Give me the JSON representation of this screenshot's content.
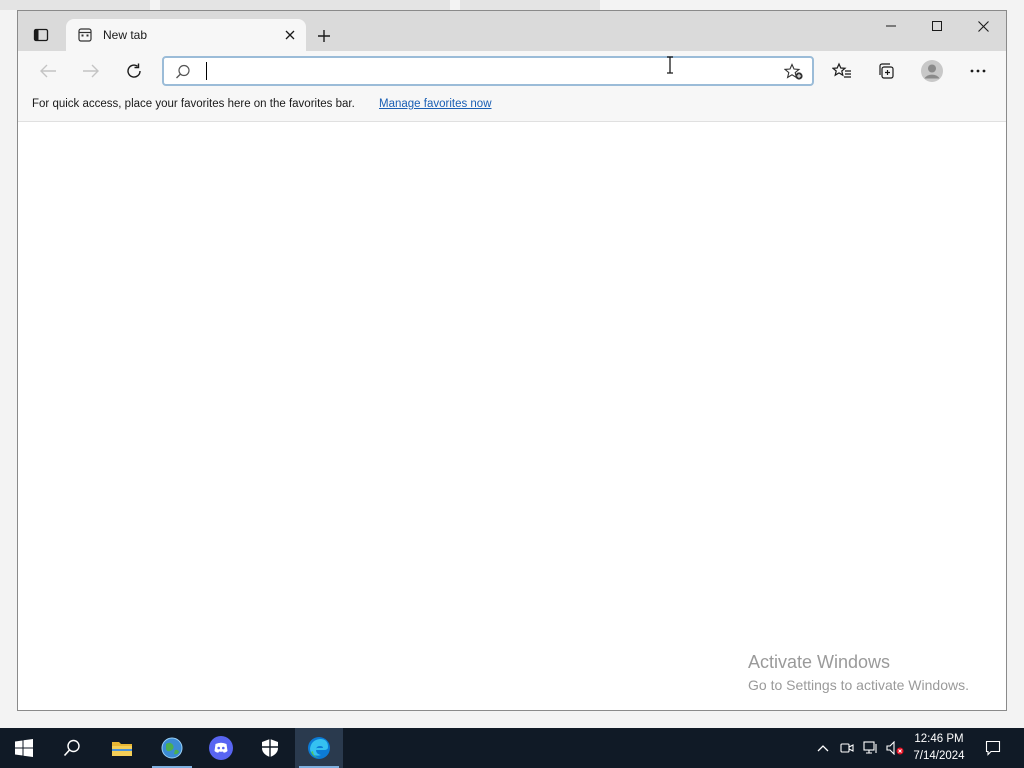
{
  "browser": {
    "tab": {
      "title": "New tab"
    },
    "address_bar": {
      "value": "",
      "placeholder": ""
    },
    "favorites_bar": {
      "message": "For quick access, place your favorites here on the favorites bar.",
      "link_label": "Manage favorites now"
    }
  },
  "watermark": {
    "title": "Activate Windows",
    "subtitle": "Go to Settings to activate Windows."
  },
  "taskbar": {
    "apps": [
      "start-icon",
      "search-icon",
      "file-explorer-icon",
      "browser-globe-icon",
      "discord-icon",
      "security-shield-icon",
      "edge-icon"
    ],
    "clock": {
      "time": "12:46 PM",
      "date": "7/14/2024"
    }
  },
  "colors": {
    "titlebar": "#dadada",
    "toolbar": "#f7f7f7",
    "taskbar": "#101a26",
    "link": "#1a5fb4",
    "edge_blue": "#0c7bd6"
  }
}
